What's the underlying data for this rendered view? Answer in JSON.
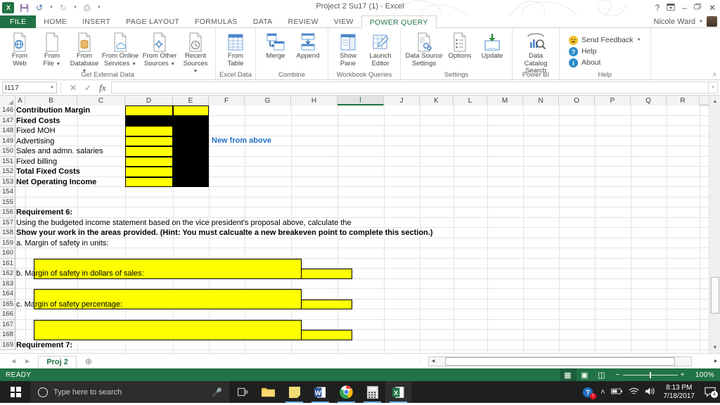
{
  "window": {
    "title": "Project 2 Su17 (1) - Excel",
    "help_icon": "?",
    "ribbon_display_icon": "ribbon-display-options",
    "minimize": "–",
    "restore": "❐",
    "close": "✕",
    "user_name": "Nicole Ward",
    "user_caret": "▾"
  },
  "qat": {
    "app_icon": "excel-logo",
    "save": "save-icon",
    "undo": "undo-icon",
    "redo": "redo-icon",
    "touch": "touch-mode-icon",
    "customize": "customize-qat-icon"
  },
  "ribbon_tabs": [
    {
      "label": "FILE",
      "type": "file"
    },
    {
      "label": "HOME",
      "type": "normal"
    },
    {
      "label": "INSERT",
      "type": "normal"
    },
    {
      "label": "PAGE LAYOUT",
      "type": "normal"
    },
    {
      "label": "FORMULAS",
      "type": "normal"
    },
    {
      "label": "DATA",
      "type": "normal"
    },
    {
      "label": "REVIEW",
      "type": "normal"
    },
    {
      "label": "VIEW",
      "type": "normal"
    },
    {
      "label": "POWER QUERY",
      "type": "active"
    }
  ],
  "ribbon": {
    "collapse_icon": "˄",
    "groups": [
      {
        "label": "Get External Data",
        "buttons": [
          {
            "caption": "From",
            "caption2": "Web",
            "icon": "from-web-icon",
            "dropdown": false
          },
          {
            "caption": "From",
            "caption2": "File",
            "icon": "from-file-icon",
            "dropdown": true
          },
          {
            "caption": "From",
            "caption2": "Database",
            "icon": "from-database-icon",
            "dropdown": true
          },
          {
            "caption": "From Online",
            "caption2": "Services",
            "icon": "from-online-services-icon",
            "dropdown": true
          },
          {
            "caption": "From Other",
            "caption2": "Sources",
            "icon": "from-other-sources-icon",
            "dropdown": true
          },
          {
            "caption": "Recent",
            "caption2": "Sources",
            "icon": "recent-sources-icon",
            "dropdown": true
          }
        ]
      },
      {
        "label": "Excel Data",
        "buttons": [
          {
            "caption": "From",
            "caption2": "Table",
            "icon": "from-table-icon",
            "dropdown": false
          }
        ]
      },
      {
        "label": "Combine",
        "buttons": [
          {
            "caption": "Merge",
            "caption2": "",
            "icon": "merge-icon",
            "dropdown": false
          },
          {
            "caption": "Append",
            "caption2": "",
            "icon": "append-icon",
            "dropdown": false
          }
        ]
      },
      {
        "label": "Workbook Queries",
        "buttons": [
          {
            "caption": "Show",
            "caption2": "Pane",
            "icon": "show-pane-icon",
            "dropdown": false
          },
          {
            "caption": "Launch",
            "caption2": "Editor",
            "icon": "launch-editor-icon",
            "dropdown": false
          }
        ]
      },
      {
        "label": "Settings",
        "buttons": [
          {
            "caption": "Data Source",
            "caption2": "Settings",
            "icon": "data-source-settings-icon",
            "dropdown": false
          },
          {
            "caption": "Options",
            "caption2": "",
            "icon": "options-icon",
            "dropdown": false
          },
          {
            "caption": "Update",
            "caption2": "",
            "icon": "update-icon",
            "dropdown": false
          }
        ]
      },
      {
        "label": "Power BI",
        "buttons": [
          {
            "caption": "Data Catalog",
            "caption2": "Search",
            "icon": "data-catalog-search-icon",
            "dropdown": false
          }
        ]
      }
    ],
    "help_group": {
      "label": "Help",
      "items": [
        {
          "label": "Send Feedback",
          "icon": "smiley-icon",
          "color": "#f2c12e",
          "dropdown": true
        },
        {
          "label": "Help",
          "icon": "help-icon",
          "color": "#2b8ccc",
          "dropdown": false
        },
        {
          "label": "About",
          "icon": "about-icon",
          "color": "#2b8ccc",
          "dropdown": false
        }
      ]
    }
  },
  "formula_bar": {
    "name_box_value": "I117",
    "cancel_icon": "✕",
    "enter_icon": "✓",
    "function_icon": "fx",
    "formula_value": "",
    "expand_icon": "˅"
  },
  "grid": {
    "columns": [
      "A",
      "B",
      "C",
      "D",
      "E",
      "F",
      "G",
      "H",
      "I",
      "J",
      "K",
      "L",
      "M",
      "N",
      "O",
      "P",
      "Q",
      "R"
    ],
    "selected_column": "I",
    "rows": [
      "146",
      "147",
      "148",
      "149",
      "150",
      "151",
      "152",
      "153",
      "154",
      "155",
      "156",
      "157",
      "158",
      "159",
      "160",
      "161",
      "162",
      "163",
      "164",
      "165",
      "166",
      "167",
      "168",
      "169"
    ],
    "cells": [
      {
        "row": "146",
        "col": "A",
        "text": "Contribution Margin",
        "bold": true
      },
      {
        "row": "147",
        "col": "A",
        "text": "Fixed Costs",
        "bold": true
      },
      {
        "row": "148",
        "col": "A",
        "text": "Fixed MOH",
        "bold": false
      },
      {
        "row": "149",
        "col": "A",
        "text": "Advertising",
        "bold": false
      },
      {
        "row": "150",
        "col": "A",
        "text": "Sales and admn. salaries",
        "bold": false
      },
      {
        "row": "151",
        "col": "A",
        "text": "Fixed billing",
        "bold": false
      },
      {
        "row": "152",
        "col": "A",
        "text": "Total Fixed Costs",
        "bold": true
      },
      {
        "row": "153",
        "col": "A",
        "text": "Net Operating Income",
        "bold": true
      },
      {
        "row": "156",
        "col": "A",
        "text": "Requirement 6:",
        "bold": true
      },
      {
        "row": "157",
        "col": "A",
        "text": "Using the budgeted income statement based on the vice president's proposal above, calculate the",
        "bold": false
      },
      {
        "row": "158",
        "col": "A",
        "text": "Show your work in the areas provided.  (Hint:  You must calcualte a new breakeven point to complete this section.)",
        "bold": true
      },
      {
        "row": "159",
        "col": "A",
        "text": "a.  Margin of safety in units:",
        "bold": false
      },
      {
        "row": "162",
        "col": "A",
        "text": "b.  Margin of safety in dollars of sales:",
        "bold": false
      },
      {
        "row": "165",
        "col": "A",
        "text": "c.  Margin of safety percentage:",
        "bold": false
      },
      {
        "row": "169",
        "col": "A",
        "text": "Requirement 7:",
        "bold": true
      }
    ],
    "annotation": {
      "text": "New from above",
      "color": "#1f6fc4",
      "row": "149",
      "col": "F"
    }
  },
  "sheet_bar": {
    "first_icon": "◀",
    "prev_icon": "▶",
    "tabs": [
      {
        "label": "Proj 2",
        "active": true
      }
    ],
    "add_sheet_icon": "⊕",
    "scroll_left_icon": "◀",
    "scroll_right_icon": "▶"
  },
  "status_bar": {
    "status": "READY",
    "views": [
      {
        "icon": "normal-view-icon",
        "glyph": "▦",
        "active": true
      },
      {
        "icon": "page-layout-view-icon",
        "glyph": "▣",
        "active": false
      },
      {
        "icon": "page-break-preview-icon",
        "glyph": "◫",
        "active": false
      }
    ],
    "zoom_out": "−",
    "zoom_in": "+",
    "zoom_level": "100%"
  },
  "taskbar": {
    "start_icon": "windows-start-icon",
    "search_placeholder": "Type here to search",
    "cortana_icon": "cortana-circle-icon",
    "mic_icon": "microphone-icon",
    "task_view_icon": "task-view-icon",
    "apps": [
      {
        "name": "file-explorer-icon",
        "open": false
      },
      {
        "name": "sticky-notes-icon",
        "open": true
      },
      {
        "name": "word-icon",
        "open": true
      },
      {
        "name": "chrome-icon",
        "open": true
      },
      {
        "name": "calculator-icon",
        "open": true
      },
      {
        "name": "excel-icon",
        "open": true
      }
    ],
    "tray": {
      "security_icon": "security-alert-icon",
      "chevron_icon": "˄",
      "battery_icon": "battery-icon",
      "wifi_icon": "wifi-icon",
      "volume_icon": "volume-icon",
      "time": "8:13 PM",
      "date": "7/18/2017",
      "action_center_icon": "action-center-icon",
      "notification_count": "4"
    }
  }
}
